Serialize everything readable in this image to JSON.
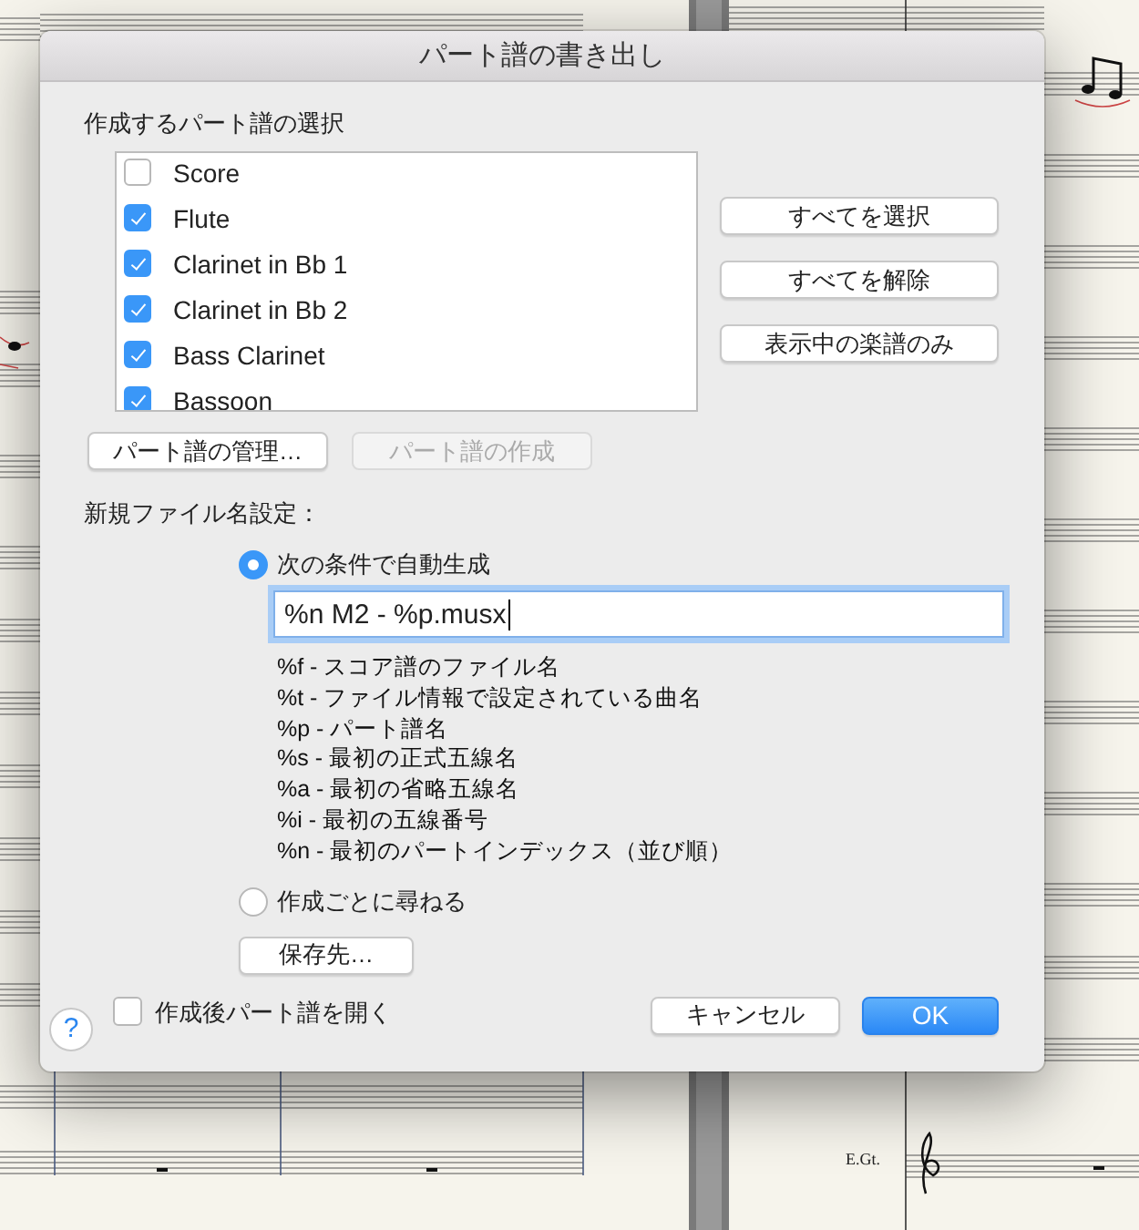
{
  "background": {
    "staff_label": "E.Gt."
  },
  "dialog": {
    "title": "パート譜の書き出し",
    "parts_heading": "作成するパート譜の選択",
    "parts": [
      {
        "name": "Score",
        "checked": false
      },
      {
        "name": "Flute",
        "checked": true
      },
      {
        "name": "Clarinet in Bb 1",
        "checked": true
      },
      {
        "name": "Clarinet in Bb 2",
        "checked": true
      },
      {
        "name": "Bass Clarinet",
        "checked": true
      },
      {
        "name": "Bassoon",
        "checked": true
      }
    ],
    "side_buttons": [
      "すべてを選択",
      "すべてを解除",
      "表示中の楽譜のみ"
    ],
    "list_buttons": [
      {
        "label": "パート譜の管理…",
        "disabled": false
      },
      {
        "label": "パート譜の作成",
        "disabled": true
      }
    ],
    "filename_heading": "新規ファイル名設定：",
    "filename_options": [
      {
        "label": "次の条件で自動生成",
        "selected": true
      },
      {
        "label": "作成ごとに尋ねる",
        "selected": false
      }
    ],
    "pattern": {
      "value": "%n M2 - %p.musx"
    },
    "tokens": [
      "%f - スコア譜のファイル名",
      "%t - ファイル情報で設定されている曲名",
      "%p - パート譜名",
      "%s - 最初の正式五線名",
      "%a - 最初の省略五線名",
      "%i - 最初の五線番号",
      "%n - 最初のパートインデックス（並び順）"
    ],
    "location_button": "保存先…",
    "help_button": "?",
    "open_after": {
      "label": "作成後パート譜を開く",
      "checked": false
    },
    "cancel_button": "キャンセル",
    "ok_button": "OK"
  }
}
